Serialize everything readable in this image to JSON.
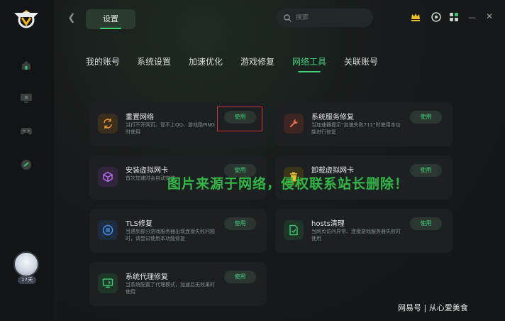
{
  "header": {
    "title": "设置",
    "search_placeholder": "搜索"
  },
  "tabs": [
    {
      "label": "我的账号",
      "active": false
    },
    {
      "label": "系统设置",
      "active": false
    },
    {
      "label": "加速优化",
      "active": false
    },
    {
      "label": "游戏修复",
      "active": false
    },
    {
      "label": "网络工具",
      "active": true
    },
    {
      "label": "关联账号",
      "active": false
    }
  ],
  "cards": [
    {
      "title": "重置网络",
      "desc": "当打不开网页、登不上QQ、游戏跳PING时使用",
      "button": "使用",
      "icon": "refresh-icon",
      "icon_bg": "#3b2e1c",
      "icon_color": "#e5962f"
    },
    {
      "title": "系统服务修复",
      "desc": "当加速器提示“加速失败711”时使用本功能进行修复",
      "button": "使用",
      "icon": "wrench-icon",
      "icon_bg": "#3d2622",
      "icon_color": "#e56d4e"
    },
    {
      "title": "安装虚拟网卡",
      "desc": "首次加速时会自动安装",
      "button": "使用",
      "icon": "cube-icon",
      "icon_bg": "#33243d",
      "icon_color": "#b66ee8"
    },
    {
      "title": "卸载虚拟网卡",
      "desc": "",
      "button": "使用",
      "icon": "trash-icon",
      "icon_bg": "#3b3418",
      "icon_color": "#e3c22e"
    },
    {
      "title": "TLS修复",
      "desc": "当遇到部分游戏服务器出现连接失败问题时，请尝试使用本功能修复",
      "button": "使用",
      "icon": "tls-icon",
      "icon_bg": "#1e2c40",
      "icon_color": "#4a91ea"
    },
    {
      "title": "hosts清理",
      "desc": "当网页访问异常、连接游戏服务器失败时使用",
      "button": "使用",
      "icon": "doc-check-icon",
      "icon_bg": "#1f3527",
      "icon_color": "#3fc36f"
    },
    {
      "title": "系统代理修复",
      "desc": "当系统配置了代理模式，加速后无效果时使用",
      "button": "使用",
      "icon": "monitor-icon",
      "icon_bg": "#1f3527",
      "icon_color": "#3fc36f"
    }
  ],
  "avatar_badge": "17天",
  "watermark": "图片来源于网络，侵权联系站长删除！",
  "source_tag": "网易号 | 从心爱美食",
  "accent": "#43d17a"
}
